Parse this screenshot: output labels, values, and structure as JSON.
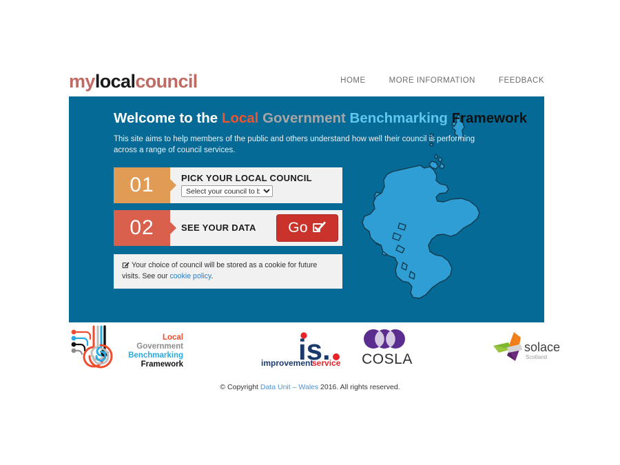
{
  "header": {
    "brand": {
      "part1": "my",
      "part2": "local",
      "part3": "council"
    },
    "nav": [
      {
        "label": "HOME"
      },
      {
        "label": "MORE INFORMATION"
      },
      {
        "label": "FEEDBACK"
      }
    ]
  },
  "hero": {
    "title_words": {
      "welcome": "Welcome to the",
      "local": "Local",
      "government": "Government",
      "benchmarking": "Benchmarking",
      "framework": "Framework"
    },
    "subtitle": "This site aims to help members of the public and others understand how well their council is performing across a range of council services.",
    "steps": [
      {
        "number": "01",
        "label": "PICK YOUR LOCAL COUNCIL",
        "select_value": "Select your council to begin",
        "color": "#e09b55"
      },
      {
        "number": "02",
        "label": "SEE YOUR DATA",
        "button_label": "Go",
        "color": "#d9604c"
      }
    ],
    "cookie_notice": {
      "icon": "pencil-square-icon",
      "text_before": "Your choice of council will be stored as a cookie for future visits. See our ",
      "link_label": "cookie policy",
      "text_after": "."
    },
    "map": {
      "name": "map-of-scotland",
      "fill": "#2e9ed4",
      "stroke": "#123a4d"
    },
    "background": "#066a96"
  },
  "partners": [
    {
      "name": "local-government-benchmarking-framework-logo",
      "lines": [
        {
          "text": "Local",
          "color": "#ef4b2c"
        },
        {
          "text": "Government",
          "color": "#8c8c8c"
        },
        {
          "text": "Benchmarking",
          "color": "#29abe2"
        },
        {
          "text": "Framework",
          "color": "#111111"
        }
      ]
    },
    {
      "name": "improvement-service-logo",
      "mark": "is.",
      "word1": "improvement",
      "word2": "service",
      "colors": {
        "navy": "#1b3a6b",
        "red": "#e8232a"
      }
    },
    {
      "name": "cosla-logo",
      "text": "COSLA",
      "color": "#5b2d8e"
    },
    {
      "name": "solace-scotland-logo",
      "text": "solace",
      "subtext": "Scotland",
      "colors": {
        "orange": "#f07f1a",
        "green": "#7cb82f",
        "purple": "#6d2a7b",
        "grey": "#c8c8c8"
      }
    }
  ],
  "footer": {
    "copyright_before": "© Copyright ",
    "copyright_link": "Data Unit – Wales",
    "copyright_after": " 2016. All rights reserved."
  }
}
